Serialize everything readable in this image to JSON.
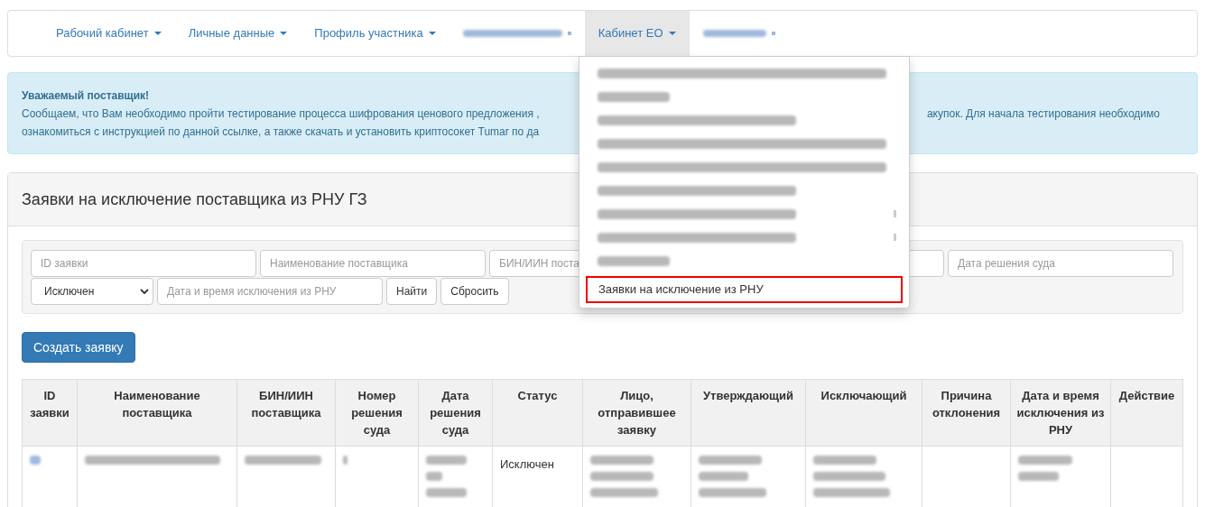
{
  "navbar": {
    "items": [
      {
        "kind": "menu",
        "label": "Рабочий кабинет",
        "selected": false
      },
      {
        "kind": "menu",
        "label": "Личные данные",
        "selected": false
      },
      {
        "kind": "menu",
        "label": "Профиль участника",
        "selected": false
      },
      {
        "kind": "redacted",
        "selected": false
      },
      {
        "kind": "menu",
        "label": "Кабинет ЕО",
        "selected": true
      },
      {
        "kind": "redacted",
        "selected": false
      }
    ]
  },
  "dropdown_menu": {
    "items": [
      {
        "kind": "redacted"
      },
      {
        "kind": "redacted"
      },
      {
        "kind": "redacted"
      },
      {
        "kind": "redacted"
      },
      {
        "kind": "redacted"
      },
      {
        "kind": "redacted"
      },
      {
        "kind": "redacted",
        "submenu": true
      },
      {
        "kind": "redacted",
        "submenu": true
      },
      {
        "kind": "redacted"
      },
      {
        "kind": "link",
        "label": "Заявки на исключение из РНУ",
        "outlined": true
      }
    ]
  },
  "alert": {
    "title": "Уважаемый поставщик!",
    "line_1_left": "Сообщаем, что Вам необходимо пройти тестирование процесса шифрования ценового предложения ,",
    "line_1_right": "акупок. Для начала тестирования необходимо",
    "line_2_left": "ознакомиться с инструкцией по данной ссылке, а также скачать и установить криптосокет Tumar по да"
  },
  "panel": {
    "title": "Заявки на исключение поставщика из РНУ ГЗ",
    "filters": {
      "row_1": [
        {
          "kind": "input",
          "placeholder": "ID заявки"
        },
        {
          "kind": "input",
          "placeholder": "Наименование поставщика"
        },
        {
          "kind": "input",
          "placeholder": "БИН/ИИН поста"
        },
        {
          "kind": "covered"
        },
        {
          "kind": "input",
          "placeholder": "Дата решения суда"
        }
      ],
      "status_select": {
        "value": "Исключен"
      },
      "datetime_field": {
        "placeholder": "Дата и время исключения из РНУ"
      },
      "buttons": [
        "Найти",
        "Сбросить"
      ]
    },
    "create_button": "Создать заявку",
    "table": {
      "columns": [
        "ID заявки",
        "Наименование поставщика",
        "БИН/ИИН поставщика",
        "Номер решения суда",
        "Дата решения суда",
        "Статус",
        "Лицо, отправившее заявку",
        "Утверждающий",
        "Исключающий",
        "Причина отклонения",
        "Дата и время исключения из РНУ",
        "Действие"
      ],
      "rows": [
        {
          "cells": [
            {
              "kind": "redacted-link"
            },
            {
              "kind": "redacted"
            },
            {
              "kind": "redacted"
            },
            {
              "kind": "redacted"
            },
            {
              "kind": "redacted"
            },
            {
              "kind": "text",
              "text": "Исключен"
            },
            {
              "kind": "redacted"
            },
            {
              "kind": "redacted"
            },
            {
              "kind": "redacted"
            },
            {
              "kind": "empty"
            },
            {
              "kind": "redacted"
            },
            {
              "kind": "empty"
            }
          ]
        }
      ]
    }
  }
}
